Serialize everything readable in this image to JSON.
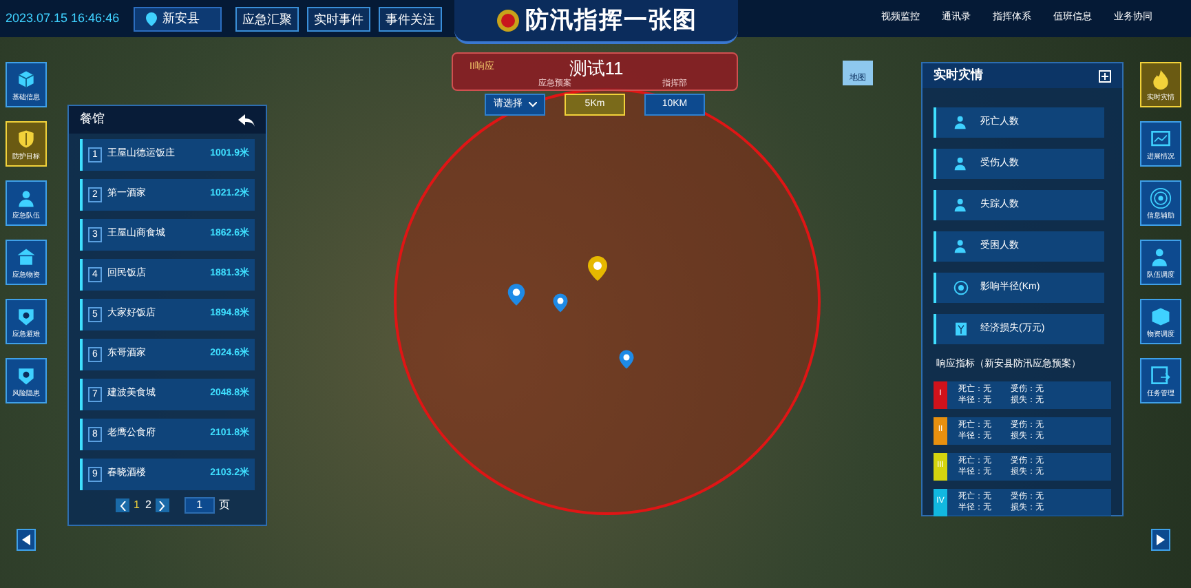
{
  "header": {
    "datetime": "2023.07.15 16:46:46",
    "location": "新安县",
    "title": "防汛指挥一张图",
    "left_buttons": [
      {
        "label": "应急汇聚"
      },
      {
        "label": "实时事件"
      },
      {
        "label": "事件关注"
      }
    ],
    "right_nav": [
      {
        "label": "视频监控"
      },
      {
        "label": "通讯录"
      },
      {
        "label": "指挥体系"
      },
      {
        "label": "值班信息"
      },
      {
        "label": "业务协同"
      }
    ]
  },
  "left_toolbar": [
    {
      "label": "基础信息",
      "selected": false
    },
    {
      "label": "防护目标",
      "selected": true
    },
    {
      "label": "应急队伍",
      "selected": false
    },
    {
      "label": "应急物资",
      "selected": false
    },
    {
      "label": "应急避难",
      "selected": false
    },
    {
      "label": "风险隐患",
      "selected": false
    }
  ],
  "right_toolbar": [
    {
      "label": "实时灾情",
      "selected": true
    },
    {
      "label": "进展情况",
      "selected": false
    },
    {
      "label": "信息辅助",
      "selected": false
    },
    {
      "label": "队伍调度",
      "selected": false
    },
    {
      "label": "物资调度",
      "selected": false
    },
    {
      "label": "任务管理",
      "selected": false
    }
  ],
  "event_banner": {
    "response_level": "II响应",
    "title": "测试11",
    "plan": "应急预案",
    "command": "指挥部"
  },
  "radius_filter": [
    {
      "label": "请选择",
      "kind": "dropdown",
      "selected": false
    },
    {
      "label": "5Km",
      "kind": "button",
      "selected": true
    },
    {
      "label": "10KM",
      "kind": "button",
      "selected": false
    }
  ],
  "map_tools": [
    {
      "label": "地图"
    }
  ],
  "poi_panel": {
    "title": "餐馆",
    "items": [
      {
        "index": "1",
        "name": "王屋山德运饭庄",
        "distance": "1001.9米"
      },
      {
        "index": "2",
        "name": "第一酒家",
        "distance": "1021.2米"
      },
      {
        "index": "3",
        "name": "王屋山商食城",
        "distance": "1862.6米"
      },
      {
        "index": "4",
        "name": "回民饭店",
        "distance": "1881.3米"
      },
      {
        "index": "5",
        "name": "大家好饭店",
        "distance": "1894.8米"
      },
      {
        "index": "6",
        "name": "东哥酒家",
        "distance": "2024.6米"
      },
      {
        "index": "7",
        "name": "建波美食城",
        "distance": "2048.8米"
      },
      {
        "index": "8",
        "name": "老鹰公食府",
        "distance": "2101.8米"
      },
      {
        "index": "9",
        "name": "春晓酒楼",
        "distance": "2103.2米"
      }
    ],
    "pages": [
      {
        "label": "1",
        "selected": true
      },
      {
        "label": "2",
        "selected": false
      }
    ],
    "page_input": "1",
    "page_unit": "页"
  },
  "disaster_panel": {
    "title": "实时灾情",
    "stats": [
      {
        "label": "死亡人数"
      },
      {
        "label": "受伤人数"
      },
      {
        "label": "失踪人数"
      },
      {
        "label": "受困人数"
      },
      {
        "label": "影响半径(Km)"
      },
      {
        "label": "经济损失(万元)"
      }
    ],
    "response_title": "响应指标（新安县防汛应急预案）",
    "levels": [
      {
        "level": "I",
        "color": "#d0121b",
        "death": "死亡：无",
        "injured": "受伤：无",
        "radius": "半径：无",
        "loss": "损失：无"
      },
      {
        "level": "II",
        "color": "#e8900f",
        "death": "死亡：无",
        "injured": "受伤：无",
        "radius": "半径：无",
        "loss": "损失：无"
      },
      {
        "level": "III",
        "color": "#d4d40f",
        "death": "死亡：无",
        "injured": "受伤：无",
        "radius": "半径：无",
        "loss": "损失：无"
      },
      {
        "level": "IV",
        "color": "#12b8e0",
        "death": "死亡：无",
        "injured": "受伤：无",
        "radius": "半径：无",
        "loss": "损失：无"
      }
    ]
  }
}
